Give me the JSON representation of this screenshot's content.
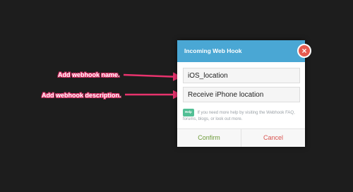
{
  "annotations": {
    "name_label": "Add webhook name.",
    "description_label": "Add webhook description."
  },
  "dialog": {
    "title": "Incoming Web Hook",
    "close_symbol": "×",
    "name_value": "iOS_location",
    "description_value": "Receive iPhone location",
    "help_badge": "Help",
    "help_text": "If you need more help by visiting the Webhook FAQ, forums, blogs, or look out more.",
    "confirm_label": "Confirm",
    "cancel_label": "Cancel"
  },
  "colors": {
    "background": "#1d1d1d",
    "header": "#4aa7d4",
    "close": "#e55a4f",
    "arrow": "#e8336d",
    "confirm": "#6e9b3a",
    "cancel": "#d9534f",
    "help_badge": "#52bf95"
  },
  "icons": [
    "close-icon",
    "arrow-icon"
  ]
}
